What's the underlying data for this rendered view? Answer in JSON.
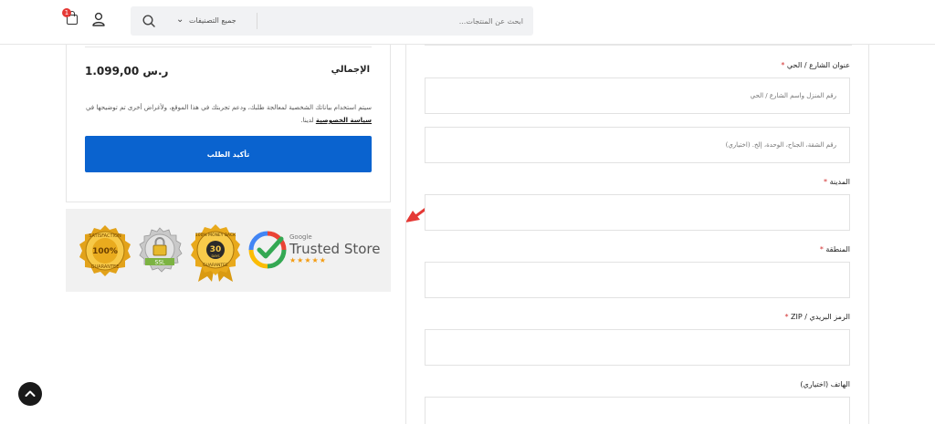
{
  "header": {
    "cart_count": "1",
    "search": {
      "category_label": "جميع التصنيفات",
      "placeholder": "ابحث عن المنتجات..."
    }
  },
  "summary": {
    "total_label": "الإجمالي",
    "total_value": "1.099,00 ر.س",
    "privacy_text_before": "سيتم استخدام بياناتك الشخصية لمعالجة طلبك، ودعم تجربتك في هذا الموقع، ولأغراض أخرى تم توضيحها في ",
    "privacy_link": "سياسة الخصوصية",
    "privacy_text_after": " لدينا.",
    "confirm_button": "تأكيد الطلب"
  },
  "badges": {
    "satisfaction": {
      "top": "SATISFACTION",
      "center": "100%",
      "bottom": "GUARANTEE"
    },
    "ssl": {
      "label": "SSL"
    },
    "money_back": {
      "top": "100% MONEY BACK",
      "number": "30",
      "unit": "DAYS",
      "bottom": "GUARANTEE"
    },
    "google": {
      "brand": "Google",
      "title": "Trusted Store",
      "stars": "★★★★★"
    }
  },
  "form": {
    "street_label": "عنوان الشارع / الحي",
    "street_placeholder": "رقم المنزل واسم الشارع / الحي",
    "apartment_placeholder": "رقم الشقة، الجناح، الوحدة، إلخ. (اختياري)",
    "city_label": "المدينة",
    "region_label": "المنطقة",
    "zip_label": "الرمز البريدي / ZIP",
    "phone_label": "الهاتف (اختياري)",
    "required_mark": "*"
  },
  "colors": {
    "accent": "#0a63cf",
    "required": "#d32f2f",
    "arrow": "#e53935"
  },
  "icons": {
    "cart": "shopping-bag-icon",
    "user": "user-icon",
    "search": "search-icon",
    "dropdown": "chevron-down-icon",
    "back_to_top": "chevron-up-icon"
  }
}
